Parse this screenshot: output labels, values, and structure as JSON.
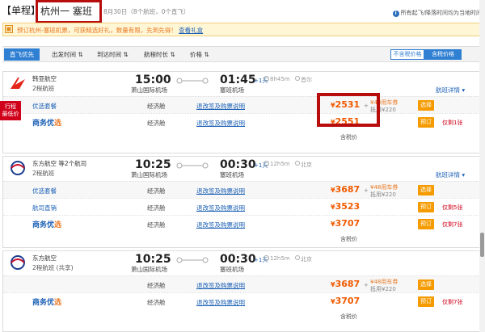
{
  "header": {
    "trip_type": "【单程】",
    "route": "杭州一 塞班",
    "date_info": "8月30日（8个航班，0个直飞）",
    "note": "所有起飞/降落时间均为当地时间",
    "note_icon": "info-icon"
  },
  "promo": {
    "icon": "gift-icon",
    "text": "预订杭州-塞班机票，可获精选好礼，数量有限，先到先得！",
    "link": "查看礼盒"
  },
  "sortbar": {
    "active": "直飞优先",
    "items": [
      "出发时间",
      "到达时间",
      "航程时长",
      "价格"
    ],
    "toggle_exclude": "不含税价格",
    "toggle_include": "含税价格"
  },
  "flights": [
    {
      "airline": "韩亚航空",
      "subtype": "2程航班",
      "dep_time": "15:00",
      "dep_airport": "萧山国际机场",
      "arr_time": "01:45",
      "plus_day": "+1天",
      "arr_airport": "塞班机场",
      "duration": "8h45m",
      "stop": "首尔",
      "detail": "航班详情",
      "ribbon": "行程\n最低价",
      "fares": [
        {
          "package": "优选套餐",
          "cabin": "经济舱",
          "rules": "退改签及购票说明",
          "price": "2531",
          "coupon": "¥48用车券",
          "offset": "抵用¥220",
          "button": "选择",
          "left": ""
        },
        {
          "package": "商务优选",
          "cabin": "经济舱",
          "rules": "退改签及购票说明",
          "price": "2551",
          "button": "预订",
          "left": "仅剩1张"
        }
      ],
      "tax_note": "含税价"
    },
    {
      "airline": "东方航空  等2个航司",
      "subtype": "2程航班",
      "dep_time": "10:25",
      "dep_airport": "萧山国际机场",
      "arr_time": "00:30",
      "plus_day": "+1天",
      "arr_airport": "塞班机场",
      "duration": "12h5m",
      "stop": "北京",
      "detail": "航班详情",
      "fares": [
        {
          "package": "优选套餐",
          "cabin": "经济舱",
          "rules": "退改签及购票说明",
          "price": "3687",
          "coupon": "¥48用车券",
          "offset": "抵用¥220",
          "button": "选择",
          "left": ""
        },
        {
          "package": "航司直销",
          "cabin": "经济舱",
          "rules": "退改签及购票说明",
          "price": "3523",
          "button": "预订",
          "left": "仅剩5张"
        },
        {
          "package": "商务优选",
          "cabin": "经济舱",
          "rules": "退改签及购票说明",
          "price": "3707",
          "button": "预订",
          "left": "仅剩7张"
        }
      ],
      "tax_note": "含税价"
    },
    {
      "airline": "东方航空",
      "subtype": "2程航班  (共享)",
      "dep_time": "10:25",
      "dep_airport": "萧山国际机场",
      "arr_time": "00:30",
      "plus_day": "+1天",
      "arr_airport": "塞班机场",
      "duration": "12h5m",
      "stop": "北京",
      "detail": "",
      "fares": [
        {
          "package": "",
          "cabin": "经济舱",
          "rules": "退改签及购票说明",
          "price": "3687",
          "coupon": "¥48用车券",
          "offset": "抵用¥220",
          "button": "选择",
          "left": ""
        },
        {
          "package": "商务优选",
          "cabin": "经济舱",
          "rules": "退改签及购票说明",
          "price": "3707",
          "button": "预订",
          "left": "仅剩7张"
        }
      ],
      "tax_note": "含税价"
    }
  ],
  "colors": {
    "accent_blue": "#2f7fd2",
    "price_orange": "#f05a00",
    "button_orange": "#f59b00",
    "highlight_red": "#b80d0d"
  }
}
